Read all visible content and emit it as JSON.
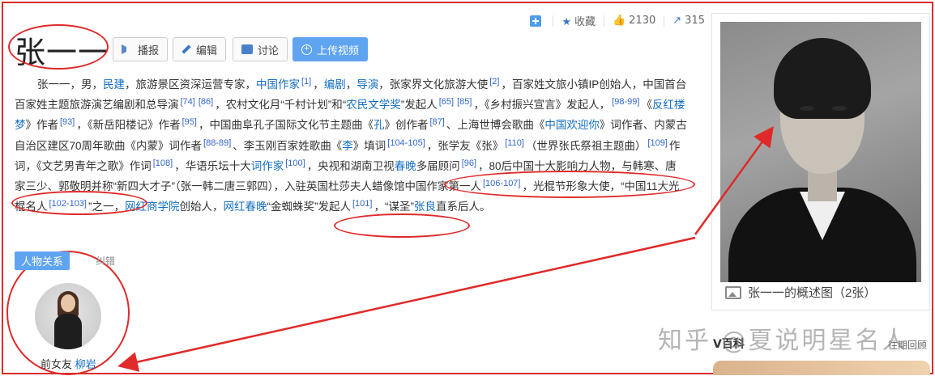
{
  "title": "张一一",
  "buttons": {
    "broadcast": "播报",
    "edit": "编辑",
    "discuss": "讨论",
    "upload_video": "上传视频"
  },
  "stats": {
    "favorite": "收藏",
    "likes": "2130",
    "shares": "315"
  },
  "paragraph": {
    "s01": "张一一，男，",
    "s02": "民建",
    "s03": "，旅游景区资深运营专家，",
    "s04": "中国作家",
    "r01": "[1]",
    "s05": "，",
    "s06": "编剧",
    "s07": "，",
    "s08": "导演",
    "s09": "，张家界文化旅游大使",
    "r02": "[2]",
    "s10": "，百家姓文旅小镇IP创始人，中国首台百家姓主题旅游演艺编剧和总导演",
    "r03": "[74]",
    "r04": "[86]",
    "s11": "，农村文化月“千村计划”和“",
    "s12": "农民文学奖",
    "s13": "”发起人",
    "r05": "[65]",
    "r06": "[85]",
    "s14": "，《乡村振兴宣言》发起人，",
    "r07": "[98-99]",
    "s15": "《",
    "s16": "反红楼梦",
    "s17": "》作者",
    "r08": "[93]",
    "s18": "，《新岳阳楼记》作者",
    "r09": "[95]",
    "s19": "，中国曲阜孔子国际文化节主题曲《",
    "s20": "孔",
    "s21": "》创作者",
    "r10": "[87]",
    "s22": "、上海世博会歌曲《",
    "s23": "中国欢迎你",
    "s24": "》词作者、内蒙古自治区建区70周年歌曲《内蒙》词作者",
    "r11": "[88-89]",
    "s25": "、李玉刚百家姓歌曲《",
    "s26": "李",
    "s27": "》填词",
    "r12": "[104-105]",
    "s28": "，张学友《张》",
    "r13": "[110]",
    "s29": "（世界张氏祭祖主题曲）",
    "r14": "[109]",
    "s30": "作词，《文艺男青年之歌》作词",
    "r15": "[108]",
    "s31": "，华语乐坛十大",
    "s32": "词作家",
    "r16": "[100]",
    "s33": "，央视和湖南卫视",
    "s34": "春晚",
    "s35": "多届顾问",
    "r17": "[96]",
    "s36": "，80后中国十大影响力人物，与韩寒、唐家三少、郭敬明并称“新四大才子”（张一韩二唐三郭四）",
    "s37": "，入驻英国杜莎夫人蜡像馆中国作家第一人",
    "r18": "[106-107]",
    "s38": "，光棍节形象大使，“中国11大光棍名人",
    "r19": "[102-103]",
    "s39": "”之一，",
    "s40": "网红商学院",
    "s41": "创始人，",
    "s42": "网红春晚",
    "s43": "“金蜘蛛奖”发起人",
    "r20": "[101]",
    "s44": "，“谋圣”",
    "s45": "张良",
    "s46": "直系后人。"
  },
  "relations": {
    "tag": "人物关系",
    "errata": "纠错",
    "person_role": "前女友",
    "person_name": "柳岩"
  },
  "panel": {
    "caption": "张一一的概述图（2张）"
  },
  "footer": {
    "baike": "V百科",
    "review": "往期回顾",
    "watermark": "知乎 @夏说明星名人"
  },
  "colors": {
    "link": "#136ec2",
    "accent": "#5fa4f0",
    "annotation": "#e02a2a"
  }
}
